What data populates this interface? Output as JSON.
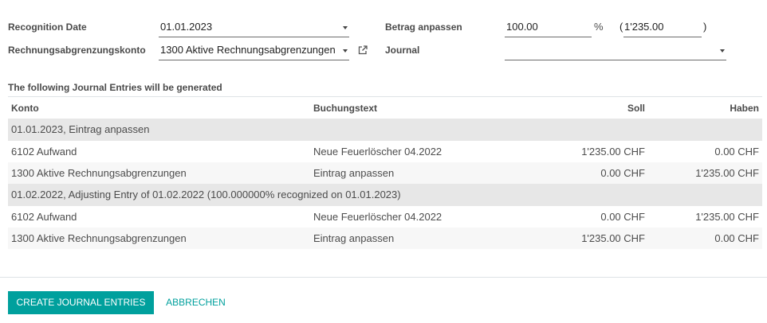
{
  "theme": {
    "primary": "#00A09D",
    "text": "#4C4C4C",
    "group_row_bg": "#E7E7E7",
    "stripe_bg": "#F7F7F7"
  },
  "icons": {
    "dropdown": "caret-down-icon",
    "open_record": "external-link-icon"
  },
  "form": {
    "recognition_date": {
      "label": "Recognition Date",
      "value": "01.01.2023"
    },
    "deferral_account": {
      "label": "Rechnungsabgrenzungskonto",
      "value": "1300 Aktive Rechnungsabgrenzungen"
    },
    "adjust_amount": {
      "label": "Betrag anpassen",
      "percent_value": "100.00",
      "percent_symbol": "%",
      "amount_prefix": "(",
      "amount_value": "1'235.00",
      "amount_suffix": ")"
    },
    "journal": {
      "label": "Journal"
    }
  },
  "entries_heading": "The following Journal Entries will be generated",
  "table": {
    "headers": {
      "account": "Konto",
      "label": "Buchungstext",
      "debit": "Soll",
      "credit": "Haben"
    },
    "groups": [
      {
        "title": "01.01.2023, Eintrag anpassen",
        "rows": [
          {
            "account": "6102 Aufwand",
            "label": "Neue Feuerlöscher 04.2022",
            "debit": "1'235.00 CHF",
            "credit": "0.00 CHF"
          },
          {
            "account": "1300 Aktive Rechnungsabgrenzungen",
            "label": "Eintrag anpassen",
            "debit": "0.00 CHF",
            "credit": "1'235.00 CHF"
          }
        ]
      },
      {
        "title": "01.02.2022, Adjusting Entry of 01.02.2022 (100.000000% recognized on 01.01.2023)",
        "rows": [
          {
            "account": "6102 Aufwand",
            "label": "Neue Feuerlöscher 04.2022",
            "debit": "0.00 CHF",
            "credit": "1'235.00 CHF"
          },
          {
            "account": "1300 Aktive Rechnungsabgrenzungen",
            "label": "Eintrag anpassen",
            "debit": "1'235.00 CHF",
            "credit": "0.00 CHF"
          }
        ]
      }
    ]
  },
  "footer": {
    "create_label": "CREATE JOURNAL ENTRIES",
    "cancel_label": "ABBRECHEN"
  }
}
